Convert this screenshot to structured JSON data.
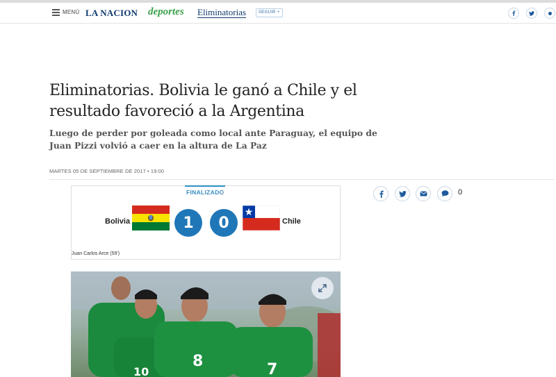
{
  "header": {
    "menu_label": "MENÚ",
    "logo": "LA NACION",
    "section_logo": "deportes",
    "section_link": "Eliminatorias",
    "follow_label": "SEGUIR +",
    "share_icons": [
      "facebook-icon",
      "twitter-icon",
      "share-icon"
    ]
  },
  "article": {
    "headline": "Eliminatorias. Bolivia le ganó a Chile y el resultado favoreció a la Argentina",
    "subhead": "Luego de perder por goleada como local ante Paraguay, el equipo de Juan Pizzi volvió a caer en la altura de La Paz",
    "date": "MARTES 05 DE SEPTIEMBRE DE 2017 • 19:00"
  },
  "match": {
    "status": "FINALIZADO",
    "home_team": "Bolivia",
    "home_score": "1",
    "away_team": "Chile",
    "away_score": "0",
    "scorer": "Juan Carlos Arce (59')"
  },
  "share": {
    "icons": [
      "facebook-icon",
      "twitter-icon",
      "email-icon",
      "comment-icon"
    ],
    "comment_count": "0"
  },
  "colors": {
    "brand_blue": "#0e3a6e",
    "deportes_green": "#3aa04a",
    "score_blue": "#1f77b8"
  }
}
